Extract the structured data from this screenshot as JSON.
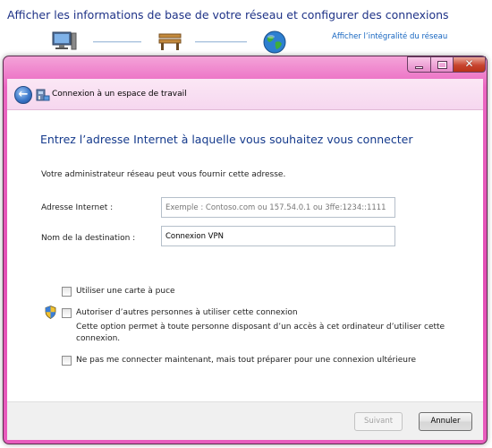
{
  "background": {
    "title": "Afficher les informations de base de votre réseau et configurer des connexions",
    "link": "Afficher l’intégralité du réseau",
    "map_icons": [
      "computer-icon",
      "bench-icon",
      "globe-icon"
    ]
  },
  "window": {
    "controls": {
      "minimize": "minimize-icon",
      "maximize": "maximize-icon",
      "close": "close-icon"
    },
    "header": {
      "back_icon": "back-arrow-icon",
      "wizard_icon": "network-connection-icon",
      "title": "Connexion à un espace de travail"
    },
    "content": {
      "heading": "Entrez l’adresse Internet à laquelle vous souhaitez vous connecter",
      "info": "Votre administrateur réseau peut vous fournir cette adresse.",
      "internet_address": {
        "label": "Adresse Internet :",
        "value": "",
        "placeholder": "Exemple : Contoso.com ou 157.54.0.1 ou 3ffe:1234::1111"
      },
      "destination_name": {
        "label": "Nom de la destination :",
        "value": "Connexion VPN"
      },
      "options": [
        {
          "label": "Utiliser une carte à puce",
          "checked": false
        },
        {
          "label": "Autoriser d’autres personnes à utiliser cette connexion",
          "checked": false,
          "icon": "security-shield-icon",
          "description": "Cette option permet à toute personne disposant d’un accès à cet ordinateur d’utiliser cette connexion."
        },
        {
          "label": "Ne pas me connecter maintenant, mais tout préparer pour une connexion ultérieure",
          "checked": false
        }
      ]
    },
    "footer": {
      "next_label": "Suivant",
      "next_enabled": false,
      "cancel_label": "Annuler"
    }
  },
  "colors": {
    "window_frame": "#e44fb6",
    "heading": "#153a8c",
    "link": "#1565c0"
  }
}
